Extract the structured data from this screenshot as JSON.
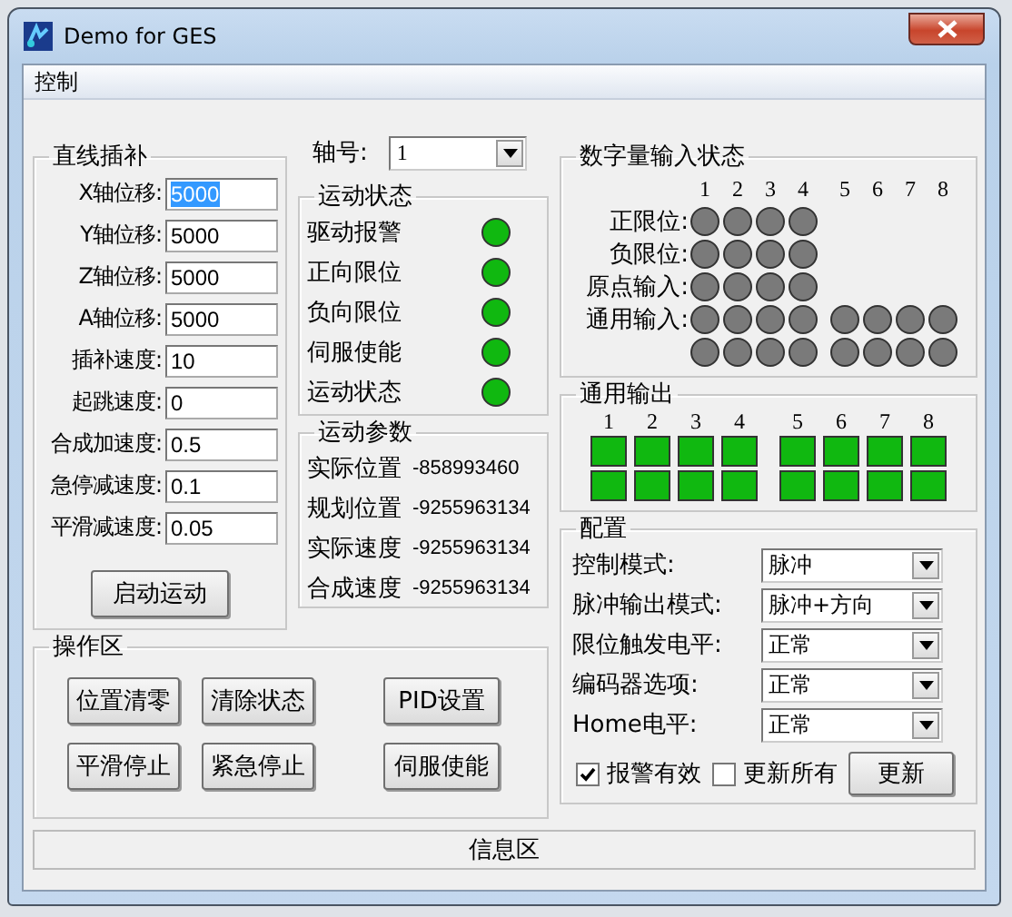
{
  "window": {
    "title": "Demo for GES"
  },
  "menu": [
    {
      "label": "控制"
    }
  ],
  "interpolation": {
    "title": "直线插补",
    "fields": [
      {
        "label": "X轴位移:",
        "value": "5000",
        "selected": true
      },
      {
        "label": "Y轴位移:",
        "value": "5000",
        "selected": false
      },
      {
        "label": "Z轴位移:",
        "value": "5000",
        "selected": false
      },
      {
        "label": "A轴位移:",
        "value": "5000",
        "selected": false
      },
      {
        "label": "插补速度:",
        "value": "10",
        "selected": false
      },
      {
        "label": "起跳速度:",
        "value": "0",
        "selected": false
      },
      {
        "label": "合成加速度:",
        "value": "0.5",
        "selected": false
      },
      {
        "label": "急停减速度:",
        "value": "0.1",
        "selected": false
      },
      {
        "label": "平滑减速度:",
        "value": "0.05",
        "selected": false
      }
    ],
    "start_button": "启动运动"
  },
  "axis": {
    "label": "轴号:",
    "value": "1"
  },
  "motion_status": {
    "title": "运动状态",
    "items": [
      {
        "label": "驱动报警",
        "on": true
      },
      {
        "label": "正向限位",
        "on": true
      },
      {
        "label": "负向限位",
        "on": true
      },
      {
        "label": "伺服使能",
        "on": true
      },
      {
        "label": "运动状态",
        "on": true
      }
    ]
  },
  "motion_params": {
    "title": "运动参数",
    "items": [
      {
        "label": "实际位置",
        "value": "-858993460"
      },
      {
        "label": "规划位置",
        "value": "-9255963134"
      },
      {
        "label": "实际速度",
        "value": "-9255963134"
      },
      {
        "label": "合成速度",
        "value": "-9255963134"
      }
    ]
  },
  "digital_inputs": {
    "title": "数字量输入状态",
    "columns": [
      "1",
      "2",
      "3",
      "4",
      "5",
      "6",
      "7",
      "8"
    ],
    "rows": [
      {
        "label": "正限位:",
        "bits": [
          false,
          false,
          false,
          false
        ]
      },
      {
        "label": "负限位:",
        "bits": [
          false,
          false,
          false,
          false
        ]
      },
      {
        "label": "原点输入:",
        "bits": [
          false,
          false,
          false,
          false
        ]
      },
      {
        "label": "通用输入:",
        "bits": [
          false,
          false,
          false,
          false,
          false,
          false,
          false,
          false
        ]
      },
      {
        "bits": [
          false,
          false,
          false,
          false,
          false,
          false,
          false,
          false
        ]
      }
    ]
  },
  "outputs": {
    "title": "通用输出",
    "columns": [
      "1",
      "2",
      "3",
      "4",
      "5",
      "6",
      "7",
      "8"
    ],
    "rows": [
      {
        "bits": [
          true,
          true,
          true,
          true,
          true,
          true,
          true,
          true
        ]
      },
      {
        "bits": [
          true,
          true,
          true,
          true,
          true,
          true,
          true,
          true
        ]
      }
    ]
  },
  "config": {
    "title": "配置",
    "fields": [
      {
        "label": "控制模式:",
        "value": "脉冲"
      },
      {
        "label": "脉冲输出模式:",
        "value": "脉冲+方向"
      },
      {
        "label": "限位触发电平:",
        "value": "正常"
      },
      {
        "label": "编码器选项:",
        "value": "正常"
      },
      {
        "label": "Home电平:",
        "value": "正常"
      }
    ],
    "checkboxes": [
      {
        "label": "报警有效",
        "checked": true
      },
      {
        "label": "更新所有",
        "checked": false
      }
    ],
    "update_button": "更新"
  },
  "operations": {
    "title": "操作区",
    "buttons": [
      "位置清零",
      "清除状态",
      "PID设置",
      "平滑停止",
      "紧急停止",
      "伺服使能"
    ]
  },
  "status_bar": {
    "text": "信息区"
  }
}
